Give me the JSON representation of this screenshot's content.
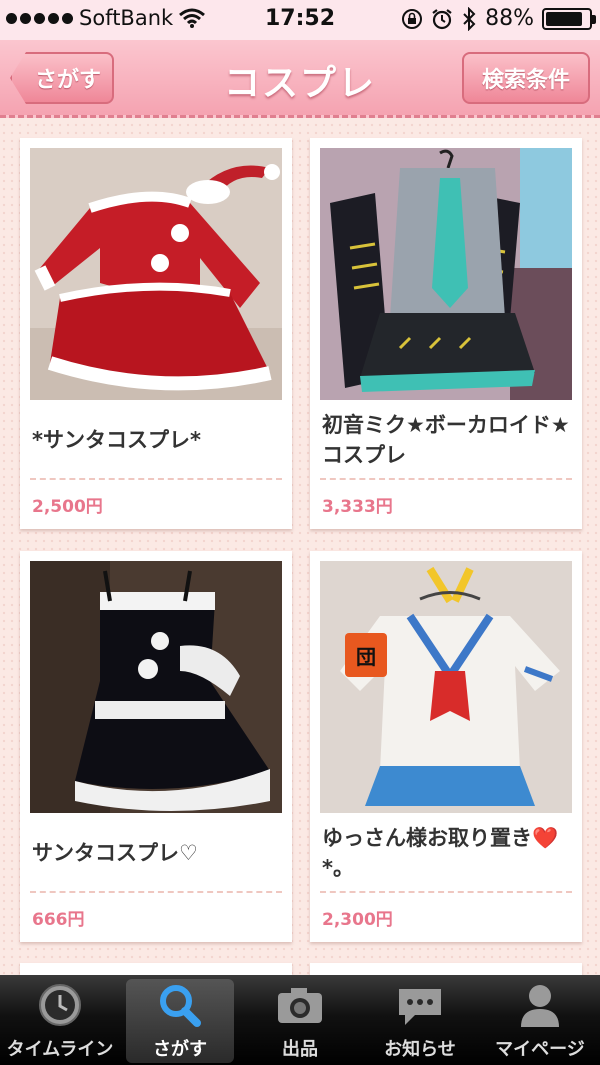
{
  "status_bar": {
    "carrier": "SoftBank",
    "time": "17:52",
    "battery_percent": "88%",
    "battery_level": 0.88
  },
  "nav": {
    "back_label": "さがす",
    "title": "コスプレ",
    "filter_label": "検索条件"
  },
  "items": [
    {
      "title": "*サンタコスプレ*",
      "price": "2,500円",
      "photo": "red-santa-costume-photo"
    },
    {
      "title": "初音ミク★ボーカロイド★コスプレ",
      "price": "3,333円",
      "photo": "miku-costume-photo"
    },
    {
      "title": "サンタコスプレ♡",
      "price": "666円",
      "photo": "black-santa-costume-photo"
    },
    {
      "title": "ゆっさん様お取り置き❤️*。",
      "price": "2,300円",
      "photo": "sailor-uniform-photo"
    }
  ],
  "tabs": [
    {
      "label": "タイムライン",
      "icon": "clock-icon",
      "selected": false
    },
    {
      "label": "さがす",
      "icon": "search-icon",
      "selected": true
    },
    {
      "label": "出品",
      "icon": "camera-icon",
      "selected": false
    },
    {
      "label": "お知らせ",
      "icon": "speech-bubble-icon",
      "selected": false
    },
    {
      "label": "マイページ",
      "icon": "person-icon",
      "selected": false
    }
  ],
  "colors": {
    "nav_pink": "#f5a3b1",
    "price_pink": "#e8768c",
    "background": "#fbe9e4"
  }
}
